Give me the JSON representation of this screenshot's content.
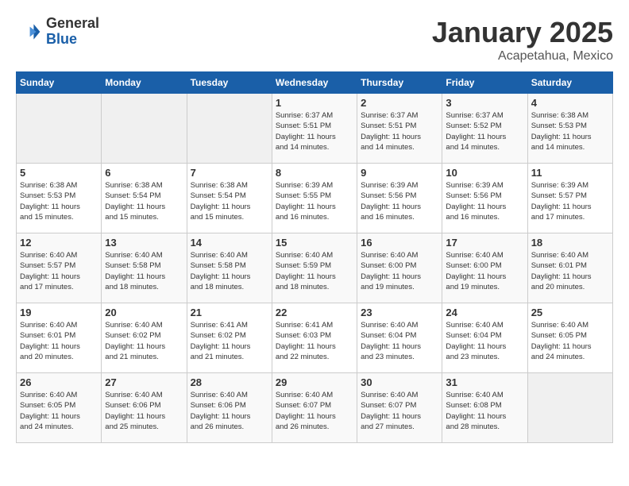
{
  "logo": {
    "general": "General",
    "blue": "Blue"
  },
  "title": {
    "month": "January 2025",
    "location": "Acapetahua, Mexico"
  },
  "weekdays": [
    "Sunday",
    "Monday",
    "Tuesday",
    "Wednesday",
    "Thursday",
    "Friday",
    "Saturday"
  ],
  "weeks": [
    [
      {
        "day": "",
        "info": ""
      },
      {
        "day": "",
        "info": ""
      },
      {
        "day": "",
        "info": ""
      },
      {
        "day": "1",
        "info": "Sunrise: 6:37 AM\nSunset: 5:51 PM\nDaylight: 11 hours\nand 14 minutes."
      },
      {
        "day": "2",
        "info": "Sunrise: 6:37 AM\nSunset: 5:51 PM\nDaylight: 11 hours\nand 14 minutes."
      },
      {
        "day": "3",
        "info": "Sunrise: 6:37 AM\nSunset: 5:52 PM\nDaylight: 11 hours\nand 14 minutes."
      },
      {
        "day": "4",
        "info": "Sunrise: 6:38 AM\nSunset: 5:53 PM\nDaylight: 11 hours\nand 14 minutes."
      }
    ],
    [
      {
        "day": "5",
        "info": "Sunrise: 6:38 AM\nSunset: 5:53 PM\nDaylight: 11 hours\nand 15 minutes."
      },
      {
        "day": "6",
        "info": "Sunrise: 6:38 AM\nSunset: 5:54 PM\nDaylight: 11 hours\nand 15 minutes."
      },
      {
        "day": "7",
        "info": "Sunrise: 6:38 AM\nSunset: 5:54 PM\nDaylight: 11 hours\nand 15 minutes."
      },
      {
        "day": "8",
        "info": "Sunrise: 6:39 AM\nSunset: 5:55 PM\nDaylight: 11 hours\nand 16 minutes."
      },
      {
        "day": "9",
        "info": "Sunrise: 6:39 AM\nSunset: 5:56 PM\nDaylight: 11 hours\nand 16 minutes."
      },
      {
        "day": "10",
        "info": "Sunrise: 6:39 AM\nSunset: 5:56 PM\nDaylight: 11 hours\nand 16 minutes."
      },
      {
        "day": "11",
        "info": "Sunrise: 6:39 AM\nSunset: 5:57 PM\nDaylight: 11 hours\nand 17 minutes."
      }
    ],
    [
      {
        "day": "12",
        "info": "Sunrise: 6:40 AM\nSunset: 5:57 PM\nDaylight: 11 hours\nand 17 minutes."
      },
      {
        "day": "13",
        "info": "Sunrise: 6:40 AM\nSunset: 5:58 PM\nDaylight: 11 hours\nand 18 minutes."
      },
      {
        "day": "14",
        "info": "Sunrise: 6:40 AM\nSunset: 5:58 PM\nDaylight: 11 hours\nand 18 minutes."
      },
      {
        "day": "15",
        "info": "Sunrise: 6:40 AM\nSunset: 5:59 PM\nDaylight: 11 hours\nand 18 minutes."
      },
      {
        "day": "16",
        "info": "Sunrise: 6:40 AM\nSunset: 6:00 PM\nDaylight: 11 hours\nand 19 minutes."
      },
      {
        "day": "17",
        "info": "Sunrise: 6:40 AM\nSunset: 6:00 PM\nDaylight: 11 hours\nand 19 minutes."
      },
      {
        "day": "18",
        "info": "Sunrise: 6:40 AM\nSunset: 6:01 PM\nDaylight: 11 hours\nand 20 minutes."
      }
    ],
    [
      {
        "day": "19",
        "info": "Sunrise: 6:40 AM\nSunset: 6:01 PM\nDaylight: 11 hours\nand 20 minutes."
      },
      {
        "day": "20",
        "info": "Sunrise: 6:40 AM\nSunset: 6:02 PM\nDaylight: 11 hours\nand 21 minutes."
      },
      {
        "day": "21",
        "info": "Sunrise: 6:41 AM\nSunset: 6:02 PM\nDaylight: 11 hours\nand 21 minutes."
      },
      {
        "day": "22",
        "info": "Sunrise: 6:41 AM\nSunset: 6:03 PM\nDaylight: 11 hours\nand 22 minutes."
      },
      {
        "day": "23",
        "info": "Sunrise: 6:40 AM\nSunset: 6:04 PM\nDaylight: 11 hours\nand 23 minutes."
      },
      {
        "day": "24",
        "info": "Sunrise: 6:40 AM\nSunset: 6:04 PM\nDaylight: 11 hours\nand 23 minutes."
      },
      {
        "day": "25",
        "info": "Sunrise: 6:40 AM\nSunset: 6:05 PM\nDaylight: 11 hours\nand 24 minutes."
      }
    ],
    [
      {
        "day": "26",
        "info": "Sunrise: 6:40 AM\nSunset: 6:05 PM\nDaylight: 11 hours\nand 24 minutes."
      },
      {
        "day": "27",
        "info": "Sunrise: 6:40 AM\nSunset: 6:06 PM\nDaylight: 11 hours\nand 25 minutes."
      },
      {
        "day": "28",
        "info": "Sunrise: 6:40 AM\nSunset: 6:06 PM\nDaylight: 11 hours\nand 26 minutes."
      },
      {
        "day": "29",
        "info": "Sunrise: 6:40 AM\nSunset: 6:07 PM\nDaylight: 11 hours\nand 26 minutes."
      },
      {
        "day": "30",
        "info": "Sunrise: 6:40 AM\nSunset: 6:07 PM\nDaylight: 11 hours\nand 27 minutes."
      },
      {
        "day": "31",
        "info": "Sunrise: 6:40 AM\nSunset: 6:08 PM\nDaylight: 11 hours\nand 28 minutes."
      },
      {
        "day": "",
        "info": ""
      }
    ]
  ]
}
